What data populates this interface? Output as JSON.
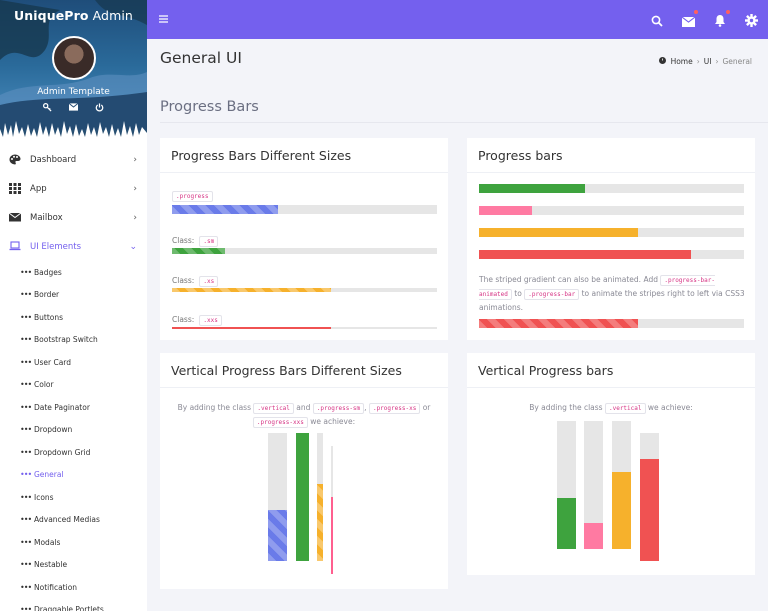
{
  "brand": {
    "bold": "UniquePro",
    "lite": " Admin"
  },
  "user": {
    "name": "Admin Template"
  },
  "sidebar": {
    "main_items": [
      {
        "label": "Dashboard",
        "icon": "palette-icon"
      },
      {
        "label": "App",
        "icon": "grid-icon"
      },
      {
        "label": "Mailbox",
        "icon": "envelope-icon"
      },
      {
        "label": "UI Elements",
        "icon": "laptop-icon"
      }
    ],
    "sub_items": [
      "Badges",
      "Border",
      "Buttons",
      "Bootstrap Switch",
      "User Card",
      "Color",
      "Date Paginator",
      "Dropdown",
      "Dropdown Grid",
      "General",
      "Icons",
      "Advanced Medias",
      "Modals",
      "Nestable",
      "Notification",
      "Draggable Portlets"
    ],
    "active_sub": "General"
  },
  "topbar": {
    "icons": [
      "menu-icon",
      "search-icon",
      "mail-icon",
      "bell-icon",
      "gear-icon"
    ]
  },
  "page": {
    "title": "General UI",
    "breadcrumb": [
      "Home",
      "UI",
      "General"
    ],
    "section": "Progress Bars"
  },
  "cards": {
    "sizes": {
      "title": "Progress Bars Different Sizes",
      "code_progress": ".progress",
      "class_label": "Class:",
      "code_sm": ".sm",
      "code_xs": ".xs",
      "code_xxs": ".xxs",
      "values": [
        0.4,
        0.2,
        0.6,
        0.6
      ]
    },
    "plain": {
      "title": "Progress bars",
      "values": [
        0.4,
        0.2,
        0.6,
        0.8
      ],
      "animated_value": 0.6,
      "text1": "The striped gradient can also be animated. Add",
      "code1": ".progress-bar-animated",
      "text2": "to",
      "code2": ".progress-bar",
      "text3": "to animate the stripes right to left via CSS3 animations."
    },
    "vsizes": {
      "title": "Vertical Progress Bars Different Sizes",
      "text1": "By adding the class",
      "code_vertical": ".vertical",
      "text_and": "and",
      "code_sm": ".progress-sm",
      "code_xs": ".progress-xs",
      "text_or": "or",
      "code_xxs": ".progress-xxs",
      "text_end": "we achieve:",
      "values": [
        0.4,
        1.0,
        0.6,
        0.6
      ]
    },
    "vplain": {
      "title": "Vertical Progress bars",
      "text1": "By adding the class",
      "code_vertical": ".vertical",
      "text_end": "we achieve:",
      "values": [
        0.4,
        0.2,
        0.6,
        0.8
      ]
    }
  },
  "colors": {
    "accent": "#7460ee",
    "blue": "#6a7be9",
    "green": "#3ea33e",
    "pink": "#ff7aa2",
    "yellow": "#f6b12c",
    "red": "#f05252",
    "track": "#e6e6e6"
  }
}
